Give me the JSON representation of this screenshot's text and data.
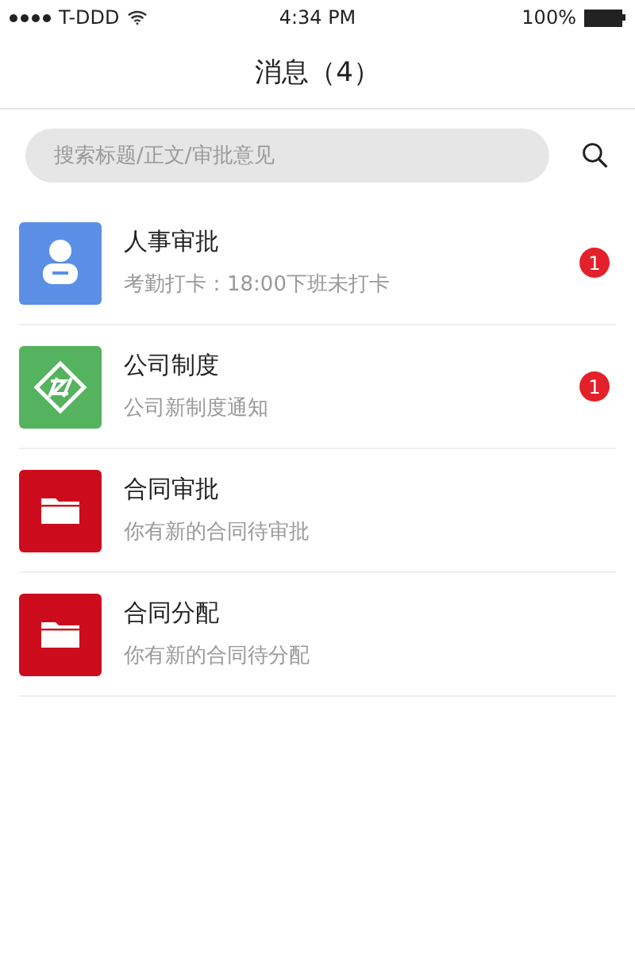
{
  "status_bar": {
    "carrier": "T-DDD",
    "time": "4:34 PM",
    "battery": "100%"
  },
  "header": {
    "title": "消息（4）"
  },
  "search": {
    "placeholder": "搜索标题/正文/审批意见"
  },
  "messages": [
    {
      "kind": "person",
      "color": "#5b8fe6",
      "title": "人事审批",
      "preview": "考勤打卡：18:00下班未打卡",
      "badge": "1"
    },
    {
      "kind": "emblem",
      "color": "#55b25e",
      "title": "公司制度",
      "preview": "公司新制度通知",
      "badge": "1"
    },
    {
      "kind": "folder",
      "color": "#cc0c1c",
      "title": "合同审批",
      "preview": "你有新的合同待审批"
    },
    {
      "kind": "folder",
      "color": "#cc0c1c",
      "title": "合同分配",
      "preview": "你有新的合同待分配"
    }
  ]
}
